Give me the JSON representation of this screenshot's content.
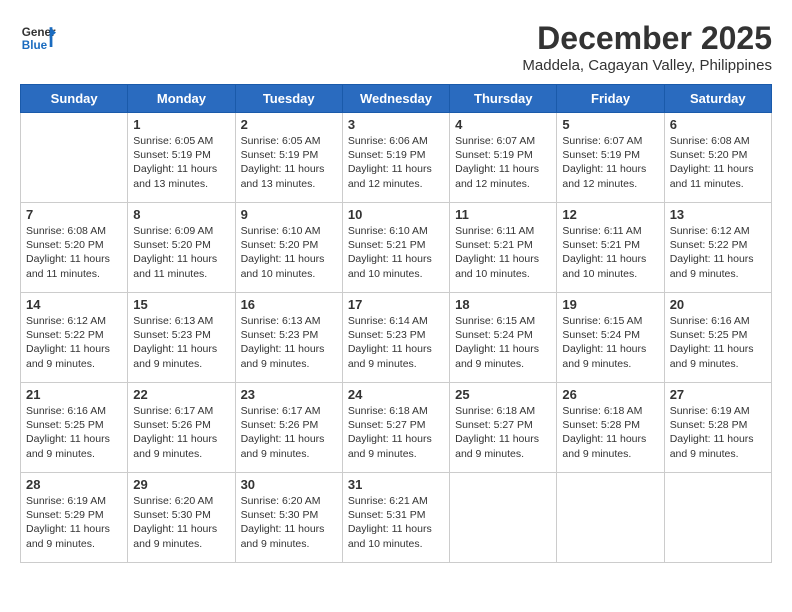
{
  "logo": {
    "general": "General",
    "blue": "Blue"
  },
  "title": "December 2025",
  "subtitle": "Maddela, Cagayan Valley, Philippines",
  "days_header": [
    "Sunday",
    "Monday",
    "Tuesday",
    "Wednesday",
    "Thursday",
    "Friday",
    "Saturday"
  ],
  "weeks": [
    [
      {
        "day": "",
        "info": ""
      },
      {
        "day": "1",
        "info": "Sunrise: 6:05 AM\nSunset: 5:19 PM\nDaylight: 11 hours\nand 13 minutes."
      },
      {
        "day": "2",
        "info": "Sunrise: 6:05 AM\nSunset: 5:19 PM\nDaylight: 11 hours\nand 13 minutes."
      },
      {
        "day": "3",
        "info": "Sunrise: 6:06 AM\nSunset: 5:19 PM\nDaylight: 11 hours\nand 12 minutes."
      },
      {
        "day": "4",
        "info": "Sunrise: 6:07 AM\nSunset: 5:19 PM\nDaylight: 11 hours\nand 12 minutes."
      },
      {
        "day": "5",
        "info": "Sunrise: 6:07 AM\nSunset: 5:19 PM\nDaylight: 11 hours\nand 12 minutes."
      },
      {
        "day": "6",
        "info": "Sunrise: 6:08 AM\nSunset: 5:20 PM\nDaylight: 11 hours\nand 11 minutes."
      }
    ],
    [
      {
        "day": "7",
        "info": "Sunrise: 6:08 AM\nSunset: 5:20 PM\nDaylight: 11 hours\nand 11 minutes."
      },
      {
        "day": "8",
        "info": "Sunrise: 6:09 AM\nSunset: 5:20 PM\nDaylight: 11 hours\nand 11 minutes."
      },
      {
        "day": "9",
        "info": "Sunrise: 6:10 AM\nSunset: 5:20 PM\nDaylight: 11 hours\nand 10 minutes."
      },
      {
        "day": "10",
        "info": "Sunrise: 6:10 AM\nSunset: 5:21 PM\nDaylight: 11 hours\nand 10 minutes."
      },
      {
        "day": "11",
        "info": "Sunrise: 6:11 AM\nSunset: 5:21 PM\nDaylight: 11 hours\nand 10 minutes."
      },
      {
        "day": "12",
        "info": "Sunrise: 6:11 AM\nSunset: 5:21 PM\nDaylight: 11 hours\nand 10 minutes."
      },
      {
        "day": "13",
        "info": "Sunrise: 6:12 AM\nSunset: 5:22 PM\nDaylight: 11 hours\nand 9 minutes."
      }
    ],
    [
      {
        "day": "14",
        "info": "Sunrise: 6:12 AM\nSunset: 5:22 PM\nDaylight: 11 hours\nand 9 minutes."
      },
      {
        "day": "15",
        "info": "Sunrise: 6:13 AM\nSunset: 5:23 PM\nDaylight: 11 hours\nand 9 minutes."
      },
      {
        "day": "16",
        "info": "Sunrise: 6:13 AM\nSunset: 5:23 PM\nDaylight: 11 hours\nand 9 minutes."
      },
      {
        "day": "17",
        "info": "Sunrise: 6:14 AM\nSunset: 5:23 PM\nDaylight: 11 hours\nand 9 minutes."
      },
      {
        "day": "18",
        "info": "Sunrise: 6:15 AM\nSunset: 5:24 PM\nDaylight: 11 hours\nand 9 minutes."
      },
      {
        "day": "19",
        "info": "Sunrise: 6:15 AM\nSunset: 5:24 PM\nDaylight: 11 hours\nand 9 minutes."
      },
      {
        "day": "20",
        "info": "Sunrise: 6:16 AM\nSunset: 5:25 PM\nDaylight: 11 hours\nand 9 minutes."
      }
    ],
    [
      {
        "day": "21",
        "info": "Sunrise: 6:16 AM\nSunset: 5:25 PM\nDaylight: 11 hours\nand 9 minutes."
      },
      {
        "day": "22",
        "info": "Sunrise: 6:17 AM\nSunset: 5:26 PM\nDaylight: 11 hours\nand 9 minutes."
      },
      {
        "day": "23",
        "info": "Sunrise: 6:17 AM\nSunset: 5:26 PM\nDaylight: 11 hours\nand 9 minutes."
      },
      {
        "day": "24",
        "info": "Sunrise: 6:18 AM\nSunset: 5:27 PM\nDaylight: 11 hours\nand 9 minutes."
      },
      {
        "day": "25",
        "info": "Sunrise: 6:18 AM\nSunset: 5:27 PM\nDaylight: 11 hours\nand 9 minutes."
      },
      {
        "day": "26",
        "info": "Sunrise: 6:18 AM\nSunset: 5:28 PM\nDaylight: 11 hours\nand 9 minutes."
      },
      {
        "day": "27",
        "info": "Sunrise: 6:19 AM\nSunset: 5:28 PM\nDaylight: 11 hours\nand 9 minutes."
      }
    ],
    [
      {
        "day": "28",
        "info": "Sunrise: 6:19 AM\nSunset: 5:29 PM\nDaylight: 11 hours\nand 9 minutes."
      },
      {
        "day": "29",
        "info": "Sunrise: 6:20 AM\nSunset: 5:30 PM\nDaylight: 11 hours\nand 9 minutes."
      },
      {
        "day": "30",
        "info": "Sunrise: 6:20 AM\nSunset: 5:30 PM\nDaylight: 11 hours\nand 9 minutes."
      },
      {
        "day": "31",
        "info": "Sunrise: 6:21 AM\nSunset: 5:31 PM\nDaylight: 11 hours\nand 10 minutes."
      },
      {
        "day": "",
        "info": ""
      },
      {
        "day": "",
        "info": ""
      },
      {
        "day": "",
        "info": ""
      }
    ]
  ]
}
